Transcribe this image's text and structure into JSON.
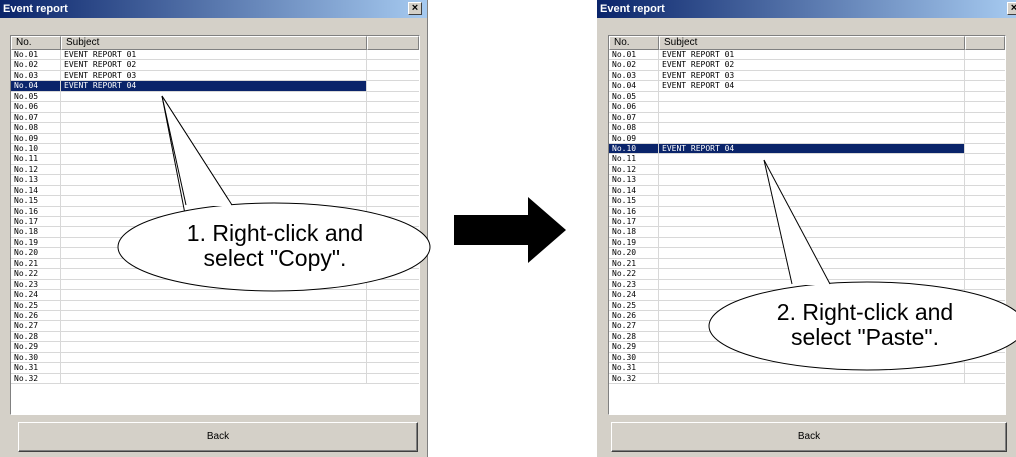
{
  "windows": [
    {
      "title": "Event report",
      "columns": [
        "No.",
        "Subject",
        ""
      ],
      "rows": [
        {
          "no": "No.01",
          "subject": "EVENT REPORT 01",
          "selected": false
        },
        {
          "no": "No.02",
          "subject": "EVENT REPORT 02",
          "selected": false
        },
        {
          "no": "No.03",
          "subject": "EVENT REPORT 03",
          "selected": false
        },
        {
          "no": "No.04",
          "subject": "EVENT REPORT 04",
          "selected": true
        },
        {
          "no": "No.05",
          "subject": "",
          "selected": false
        },
        {
          "no": "No.06",
          "subject": "",
          "selected": false
        },
        {
          "no": "No.07",
          "subject": "",
          "selected": false
        },
        {
          "no": "No.08",
          "subject": "",
          "selected": false
        },
        {
          "no": "No.09",
          "subject": "",
          "selected": false
        },
        {
          "no": "No.10",
          "subject": "",
          "selected": false
        },
        {
          "no": "No.11",
          "subject": "",
          "selected": false
        },
        {
          "no": "No.12",
          "subject": "",
          "selected": false
        },
        {
          "no": "No.13",
          "subject": "",
          "selected": false
        },
        {
          "no": "No.14",
          "subject": "",
          "selected": false
        },
        {
          "no": "No.15",
          "subject": "",
          "selected": false
        },
        {
          "no": "No.16",
          "subject": "",
          "selected": false
        },
        {
          "no": "No.17",
          "subject": "",
          "selected": false
        },
        {
          "no": "No.18",
          "subject": "",
          "selected": false
        },
        {
          "no": "No.19",
          "subject": "",
          "selected": false
        },
        {
          "no": "No.20",
          "subject": "",
          "selected": false
        },
        {
          "no": "No.21",
          "subject": "",
          "selected": false
        },
        {
          "no": "No.22",
          "subject": "",
          "selected": false
        },
        {
          "no": "No.23",
          "subject": "",
          "selected": false
        },
        {
          "no": "No.24",
          "subject": "",
          "selected": false
        },
        {
          "no": "No.25",
          "subject": "",
          "selected": false
        },
        {
          "no": "No.26",
          "subject": "",
          "selected": false
        },
        {
          "no": "No.27",
          "subject": "",
          "selected": false
        },
        {
          "no": "No.28",
          "subject": "",
          "selected": false
        },
        {
          "no": "No.29",
          "subject": "",
          "selected": false
        },
        {
          "no": "No.30",
          "subject": "",
          "selected": false
        },
        {
          "no": "No.31",
          "subject": "",
          "selected": false
        },
        {
          "no": "No.32",
          "subject": "",
          "selected": false
        }
      ],
      "back_label": "Back",
      "callout": {
        "line1": "1. Right-click and",
        "line2": "select \"Copy\"."
      }
    },
    {
      "title": "Event report",
      "columns": [
        "No.",
        "Subject",
        ""
      ],
      "rows": [
        {
          "no": "No.01",
          "subject": "EVENT REPORT 01",
          "selected": false
        },
        {
          "no": "No.02",
          "subject": "EVENT REPORT 02",
          "selected": false
        },
        {
          "no": "No.03",
          "subject": "EVENT REPORT 03",
          "selected": false
        },
        {
          "no": "No.04",
          "subject": "EVENT REPORT 04",
          "selected": false
        },
        {
          "no": "No.05",
          "subject": "",
          "selected": false
        },
        {
          "no": "No.06",
          "subject": "",
          "selected": false
        },
        {
          "no": "No.07",
          "subject": "",
          "selected": false
        },
        {
          "no": "No.08",
          "subject": "",
          "selected": false
        },
        {
          "no": "No.09",
          "subject": "",
          "selected": false
        },
        {
          "no": "No.10",
          "subject": "EVENT REPORT 04",
          "selected": true
        },
        {
          "no": "No.11",
          "subject": "",
          "selected": false
        },
        {
          "no": "No.12",
          "subject": "",
          "selected": false
        },
        {
          "no": "No.13",
          "subject": "",
          "selected": false
        },
        {
          "no": "No.14",
          "subject": "",
          "selected": false
        },
        {
          "no": "No.15",
          "subject": "",
          "selected": false
        },
        {
          "no": "No.16",
          "subject": "",
          "selected": false
        },
        {
          "no": "No.17",
          "subject": "",
          "selected": false
        },
        {
          "no": "No.18",
          "subject": "",
          "selected": false
        },
        {
          "no": "No.19",
          "subject": "",
          "selected": false
        },
        {
          "no": "No.20",
          "subject": "",
          "selected": false
        },
        {
          "no": "No.21",
          "subject": "",
          "selected": false
        },
        {
          "no": "No.22",
          "subject": "",
          "selected": false
        },
        {
          "no": "No.23",
          "subject": "",
          "selected": false
        },
        {
          "no": "No.24",
          "subject": "",
          "selected": false
        },
        {
          "no": "No.25",
          "subject": "",
          "selected": false
        },
        {
          "no": "No.26",
          "subject": "",
          "selected": false
        },
        {
          "no": "No.27",
          "subject": "",
          "selected": false
        },
        {
          "no": "No.28",
          "subject": "",
          "selected": false
        },
        {
          "no": "No.29",
          "subject": "",
          "selected": false
        },
        {
          "no": "No.30",
          "subject": "",
          "selected": false
        },
        {
          "no": "No.31",
          "subject": "",
          "selected": false
        },
        {
          "no": "No.32",
          "subject": "",
          "selected": false
        }
      ],
      "back_label": "Back",
      "callout": {
        "line1": "2. Right-click and",
        "line2": "select \"Paste\"."
      }
    }
  ],
  "icons": {
    "close": "close-icon",
    "arrow": "right-arrow-icon"
  },
  "colors": {
    "selection": "#0a246a",
    "title_gradient_start": "#0a246a",
    "title_gradient_end": "#a6caf0",
    "window_bg": "#d4d0c8"
  }
}
